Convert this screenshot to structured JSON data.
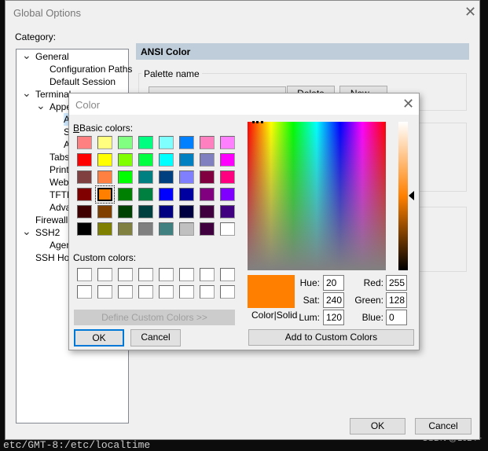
{
  "terminal_text": "etc/GMT-8:/etc/localtime",
  "watermark": "CSDN @1024+",
  "global_options": {
    "title": "Global Options",
    "category_label": "Category:",
    "tree": [
      {
        "label": "General",
        "level": 0,
        "expanded": true
      },
      {
        "label": "Configuration Paths",
        "level": 1
      },
      {
        "label": "Default Session",
        "level": 1
      },
      {
        "label": "Terminal",
        "level": 0,
        "expanded": true
      },
      {
        "label": "Appearance",
        "level": 1,
        "expanded": true
      },
      {
        "label": "ANSI Color",
        "level": 2,
        "selected": true
      },
      {
        "label": "S",
        "level": 2
      },
      {
        "label": "A",
        "level": 2
      },
      {
        "label": "Tabs",
        "level": 1
      },
      {
        "label": "Printing",
        "level": 1
      },
      {
        "label": "Web",
        "level": 1
      },
      {
        "label": "TFTP",
        "level": 1
      },
      {
        "label": "Advanced",
        "level": 1
      },
      {
        "label": "Firewall",
        "level": 0
      },
      {
        "label": "SSH2",
        "level": 0,
        "expanded": true
      },
      {
        "label": "Agent",
        "level": 1
      },
      {
        "label": "SSH Host Keys",
        "level": 0
      }
    ],
    "panel_header": "ANSI Color",
    "palette_group": "Palette name",
    "delete_label": "Delete",
    "new_label": "New...",
    "ok_label": "OK",
    "cancel_label": "Cancel",
    "header_color": "#bfcddb"
  },
  "color_dialog": {
    "title": "Color",
    "basic_colors_label": "Basic colors:",
    "custom_colors_label": "Custom colors:",
    "basic_colors": [
      "#ff8080",
      "#ffff80",
      "#80ff80",
      "#00ff80",
      "#80ffff",
      "#0080ff",
      "#ff80c0",
      "#ff80ff",
      "#ff0000",
      "#ffff00",
      "#80ff00",
      "#00ff40",
      "#00ffff",
      "#0080c0",
      "#8080c0",
      "#ff00ff",
      "#804040",
      "#ff8040",
      "#00ff00",
      "#008080",
      "#004080",
      "#8080ff",
      "#800040",
      "#ff0080",
      "#800000",
      "#ff8000",
      "#008000",
      "#008040",
      "#0000ff",
      "#0000a0",
      "#800080",
      "#8000ff",
      "#400000",
      "#804000",
      "#004000",
      "#004040",
      "#000080",
      "#000040",
      "#400040",
      "#400080",
      "#000000",
      "#808000",
      "#808040",
      "#808080",
      "#408080",
      "#c0c0c0",
      "#400040",
      "#ffffff"
    ],
    "selected_index": 25,
    "define_custom_label": "Define Custom Colors >>",
    "ok_label": "OK",
    "cancel_label": "Cancel",
    "color_solid_label": "Color|Solid",
    "hue_label": "Hue:",
    "sat_label": "Sat:",
    "lum_label": "Lum:",
    "red_label": "Red:",
    "green_label": "Green:",
    "blue_label": "Blue:",
    "hue": "20",
    "sat": "240",
    "lum": "120",
    "red": "255",
    "green": "128",
    "blue": "0",
    "current_color": "#ff8000",
    "add_custom_label": "Add to Custom Colors"
  }
}
